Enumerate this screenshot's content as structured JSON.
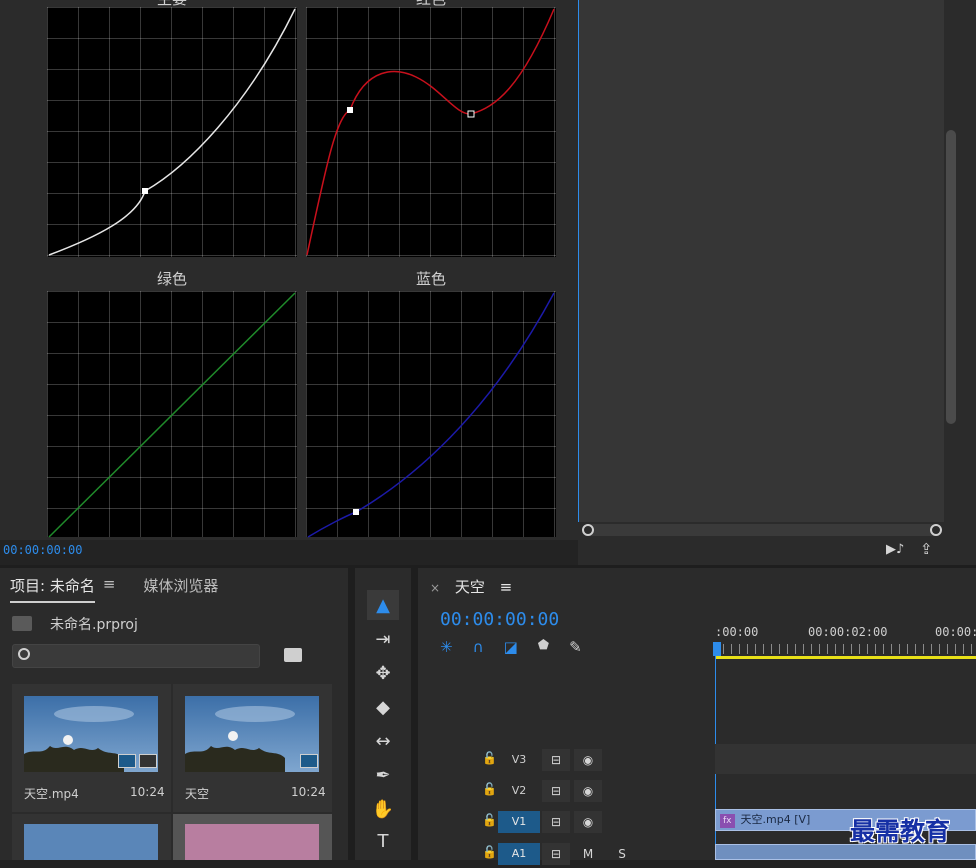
{
  "curves": {
    "master_title": "主要",
    "red_title": "红色",
    "green_title": "绿色",
    "blue_title": "蓝色"
  },
  "colors": {
    "accent": "#2d8ceb",
    "master_curve": "#e6e6e6",
    "red_curve": "#c8101c",
    "green_curve": "#1f8a2a",
    "blue_curve": "#1c1aa8",
    "playhead_yellow": "#e8e018"
  },
  "source_timecode": "00:00:00:00",
  "program": {
    "buttons": {
      "insert_icon": "▶♪",
      "export_icon": "⇪"
    }
  },
  "project": {
    "tab_project": "项目: 未命名",
    "tab_media": "媒体浏览器",
    "menu_icon": "≡",
    "file_name": "未命名.prproj",
    "search_placeholder": "",
    "items": [
      {
        "name": "天空.mp4",
        "duration": "10:24"
      },
      {
        "name": "天空",
        "duration": "10:24"
      }
    ]
  },
  "timeline": {
    "close_label": "×",
    "sequence_name": "天空",
    "menu_icon": "≡",
    "timecode": "00:00:00:00",
    "ruler": [
      ":00:00",
      "00:00:02:00",
      "00:00:0"
    ],
    "tracks": [
      {
        "name": "V3",
        "eye": "◉"
      },
      {
        "name": "V2",
        "eye": "◉"
      },
      {
        "name": "V1",
        "eye": "◉"
      },
      {
        "name": "A1",
        "m": "M",
        "s": "S"
      }
    ],
    "clip_label": "天空.mp4 [V]",
    "fx_label": "fx"
  },
  "watermark": "最需教育"
}
